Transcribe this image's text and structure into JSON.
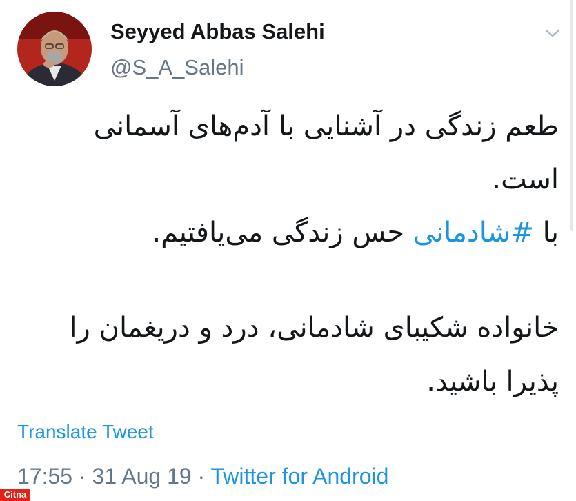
{
  "tweet": {
    "author_name": "Seyyed Abbas Salehi",
    "author_handle": "@S_A_Salehi",
    "lines": {
      "l1": "طعم زندگی در آشنایی با آدم‌های آسمانی",
      "l2": "است.",
      "l3_prefix": "با ",
      "l3_hashtag": "#شادمانی",
      "l3_suffix": " حس زندگی می‌یافتیم.",
      "l4": "خانواده شکیبای شادمانی، درد و دریغمان را",
      "l5": "پذیرا باشید."
    },
    "translate_label": "Translate Tweet",
    "time": "17:55",
    "separator": " · ",
    "date": "31 Aug 19",
    "source": "Twitter for Android"
  },
  "watermark": "Citna",
  "colors": {
    "link": "#1b95e0",
    "secondary": "#657786",
    "primary_text": "#14171a"
  },
  "icons": {
    "menu": "chevron-down-icon"
  }
}
